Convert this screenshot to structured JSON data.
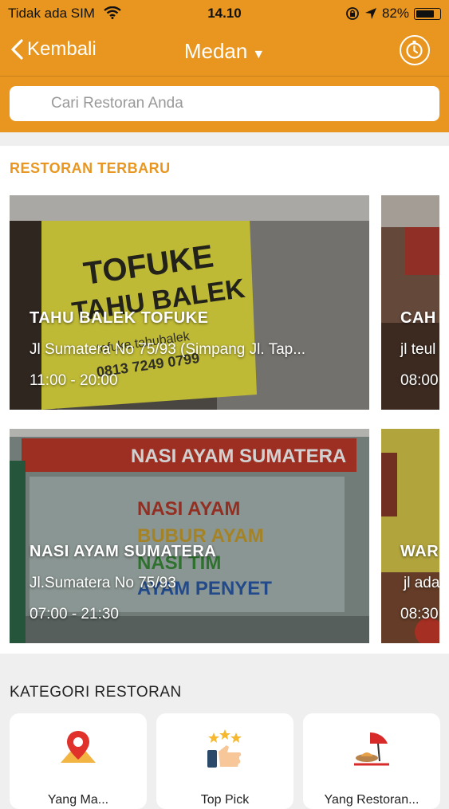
{
  "status_bar": {
    "carrier": "Tidak ada SIM",
    "time": "14.10",
    "battery": "82%",
    "battery_level": 0.82,
    "icons": [
      "wifi-icon",
      "orientation-lock-icon",
      "location-arrow-icon",
      "battery-icon"
    ]
  },
  "nav": {
    "back_label": "Kembali",
    "city": "Medan",
    "icons": [
      "chevron-left-icon",
      "caret-down-icon",
      "timer-icon"
    ]
  },
  "search": {
    "placeholder": "Cari Restoran Anda",
    "icon": "search-icon"
  },
  "colors": {
    "accent": "#e8961f",
    "background": "#efefef"
  },
  "new_restaurants": {
    "title": "RESTORAN TERBARU",
    "cards": [
      {
        "name": "TAHU BALEK TOFUKE",
        "address": "Jl Sumatera No 75/93 (Simpang Jl. Tap...",
        "hours": "11:00 - 20:00"
      },
      {
        "name": "CAH",
        "address": "jl teul",
        "hours": "08:00"
      },
      {
        "name": "NASI AYAM SUMATERA",
        "address": "Jl.Sumatera No 75/93",
        "hours": "07:00 - 21:30"
      },
      {
        "name": "WAR",
        "address": "jl ada",
        "hours": "08:30"
      }
    ],
    "photo_text": {
      "tofuke_line1": "TOFUKE",
      "tofuke_line2": "TAHU BALEK",
      "tofuke_handle": "tofuke.tahubalek",
      "tofuke_phone": "0813 7249 0799",
      "nasi_banner": "NASI AYAM SUMATERA",
      "nasi_glass_1": "NASI AYAM",
      "nasi_glass_2": "BUBUR AYAM",
      "nasi_glass_3": "NASI TIM",
      "nasi_glass_4": "AYAM PENYET"
    }
  },
  "categories": {
    "title": "KATEGORI RESTORAN",
    "items": [
      {
        "label": "Yang Ma...",
        "icon": "map-pin-icon"
      },
      {
        "label": "Top Pick",
        "icon": "thumbs-up-stars-icon"
      },
      {
        "label": "Yang Restoran...",
        "icon": "food-tray-umbrella-icon"
      }
    ]
  }
}
